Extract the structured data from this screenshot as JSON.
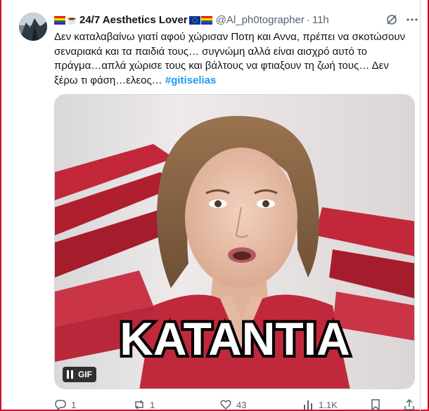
{
  "tweet": {
    "display_name": "24/7 Aesthetics Lover",
    "handle": "@Al_ph0tographer",
    "separator": "·",
    "time": "11h",
    "text": "Δεν καταλαβαίνω γιατί αφού χώρισαν Ποτη και Αννα, πρέπει να σκοτώσουν σεναριακά και τα παιδιά τους… συγνώμη αλλά είναι αισχρό αυτό το πράγμα…απλά χώρισε τους και βάλτους να φτιαξουν τη ζωή τους… Δεν ξέρω τι φάση…ελεος…",
    "hashtag": "#gitiselias"
  },
  "media": {
    "overlay_caption": "KATANTIA",
    "gif_label": "GIF",
    "controls_icon": "pause-icon"
  },
  "actions": {
    "reply_count": "1",
    "retweet_count": "1",
    "like_count": "43",
    "views_count": "1.1K"
  },
  "icons": {
    "avatar": "avatar",
    "grok": "grok-icon",
    "more": "more-icon",
    "reply": "reply-icon",
    "retweet": "retweet-icon",
    "like": "heart-icon",
    "views": "views-icon",
    "bookmark": "bookmark-icon",
    "share": "share-icon"
  },
  "colors": {
    "link": "#1d9bf0",
    "secondary_text": "#536471",
    "primary_text": "#0f1419",
    "frame": "#c8102e"
  }
}
